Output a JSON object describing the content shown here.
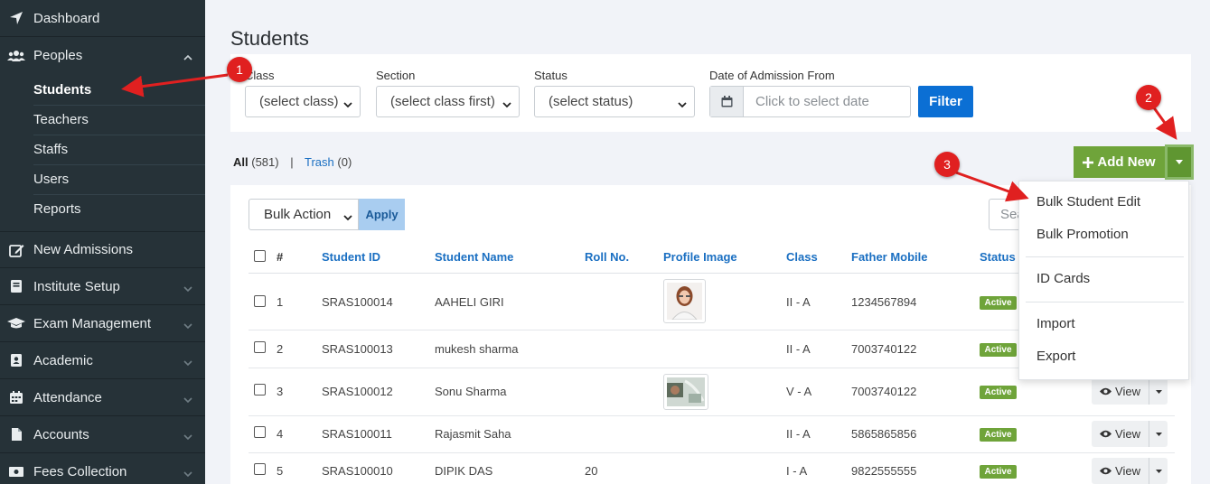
{
  "sidebar": {
    "items": [
      {
        "label": "Dashboard",
        "icon": "location-arrow-icon"
      },
      {
        "label": "Peoples",
        "icon": "users-icon"
      },
      {
        "label": "New Admissions",
        "icon": "edit-icon"
      },
      {
        "label": "Institute Setup",
        "icon": "book-icon"
      },
      {
        "label": "Exam Management",
        "icon": "graduation-cap-icon"
      },
      {
        "label": "Academic",
        "icon": "address-book-icon"
      },
      {
        "label": "Attendance",
        "icon": "calendar-icon"
      },
      {
        "label": "Accounts",
        "icon": "file-icon"
      },
      {
        "label": "Fees Collection",
        "icon": "money-bill-icon"
      }
    ],
    "sub_items": [
      "Students",
      "Teachers",
      "Staffs",
      "Users",
      "Reports"
    ]
  },
  "page": {
    "title": "Students"
  },
  "filters": {
    "class_label": "Class",
    "class_value": "(select class)",
    "section_label": "Section",
    "section_value": "(select class first)",
    "status_label": "Status",
    "status_value": "(select status)",
    "date_label": "Date of Admission From",
    "date_placeholder": "Click to select date",
    "filter_button": "Filter"
  },
  "counts": {
    "all_label": "All",
    "all_count": "(581)",
    "separator": "|",
    "trash_label": "Trash",
    "trash_count": "(0)"
  },
  "toolbar": {
    "add_new": "Add New",
    "bulk_action": "Bulk Action",
    "apply": "Apply",
    "search_placeholder": "Search"
  },
  "table": {
    "headers": [
      "#",
      "Student ID",
      "Student Name",
      "Roll No.",
      "Profile Image",
      "Class",
      "Father Mobile",
      "Status"
    ],
    "rows": [
      {
        "num": "1",
        "id": "SRAS100014",
        "name": "AAHELI GIRI",
        "roll": "",
        "has_image": true,
        "class": "II - A",
        "mobile": "1234567894",
        "status": "Active"
      },
      {
        "num": "2",
        "id": "SRAS100013",
        "name": "mukesh sharma",
        "roll": "",
        "has_image": false,
        "class": "II - A",
        "mobile": "7003740122",
        "status": "Active"
      },
      {
        "num": "3",
        "id": "SRAS100012",
        "name": "Sonu Sharma",
        "roll": "",
        "has_image": true,
        "class": "V - A",
        "mobile": "7003740122",
        "status": "Active"
      },
      {
        "num": "4",
        "id": "SRAS100011",
        "name": "Rajasmit Saha",
        "roll": "",
        "has_image": false,
        "class": "II - A",
        "mobile": "5865865856",
        "status": "Active"
      },
      {
        "num": "5",
        "id": "SRAS100010",
        "name": "DIPIK DAS",
        "roll": "20",
        "has_image": false,
        "class": "I - A",
        "mobile": "9822555555",
        "status": "Active"
      }
    ],
    "view_label": "View"
  },
  "dropdown": {
    "items": [
      "Bulk Student Edit",
      "Bulk Promotion",
      "ID Cards",
      "Import",
      "Export"
    ]
  },
  "annotations": {
    "markers": [
      "1",
      "2",
      "3"
    ]
  },
  "colors": {
    "sidebar_bg": "#263238",
    "primary": "#0b6fd4",
    "link": "#1a6fc2",
    "success": "#6fa43a",
    "annotation": "#e02020"
  }
}
